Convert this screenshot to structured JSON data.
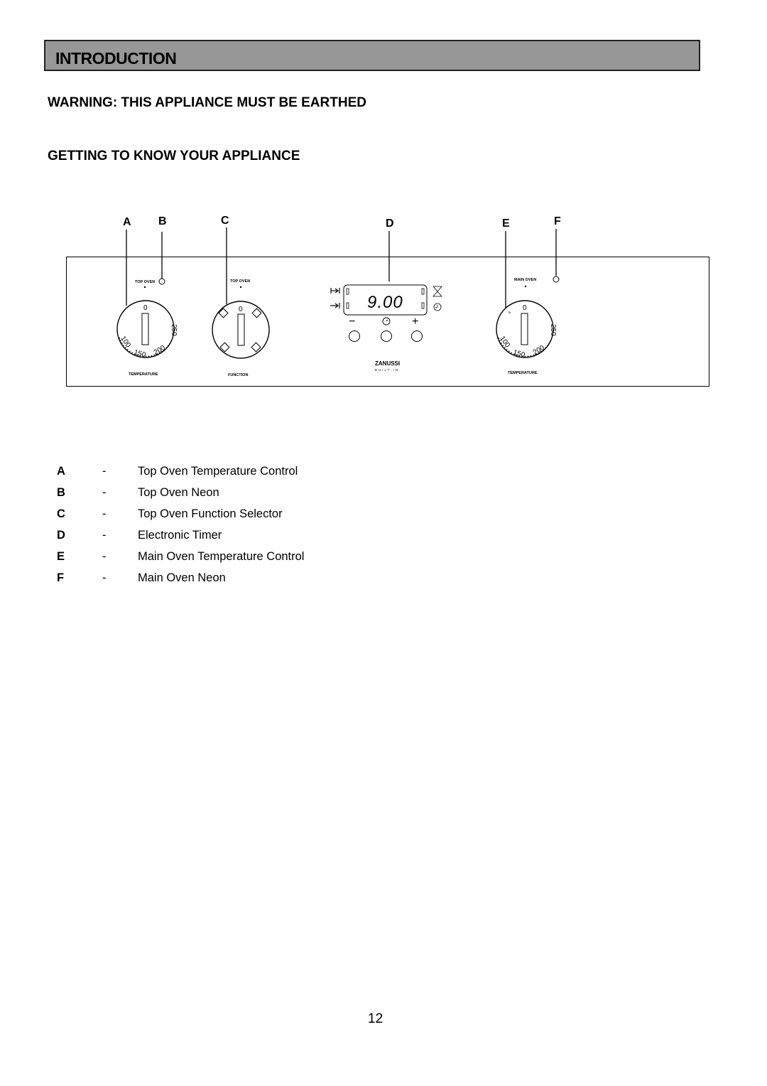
{
  "section_title": "INTRODUCTION",
  "warning_heading": "WARNING: THIS APPLIANCE MUST BE EARTHED",
  "subheading": "GETTING TO KNOW YOUR APPLIANCE",
  "diagram": {
    "callouts": [
      "A",
      "B",
      "C",
      "D",
      "E",
      "F"
    ],
    "top_oven_label_left": "TOP OVEN",
    "top_oven_label_function": "TOP OVEN",
    "main_oven_label": "MAIN OVEN",
    "dial_zero": "0",
    "dial_scale": [
      "100",
      "150",
      "200",
      "250"
    ],
    "temperature_label": "TEMPERATURE",
    "function_label": "FUNCTION",
    "timer_display": "9.00",
    "timer_minus": "−",
    "timer_plus": "+",
    "brand": "ZANUSSI",
    "brand_sub": "BUILT-IN",
    "icons": {
      "cook_time": "cook-time-icon",
      "end_time": "end-time-icon",
      "minute_minder": "hourglass-icon",
      "clock": "clock-icon",
      "manual": "manual-mode-icon"
    }
  },
  "legend": [
    {
      "key": "A",
      "dash": "-",
      "label": "Top Oven Temperature Control"
    },
    {
      "key": "B",
      "dash": "-",
      "label": "Top Oven Neon"
    },
    {
      "key": "C",
      "dash": "-",
      "label": "Top Oven Function Selector"
    },
    {
      "key": "D",
      "dash": "-",
      "label": "Electronic Timer"
    },
    {
      "key": "E",
      "dash": "-",
      "label": "Main Oven Temperature Control"
    },
    {
      "key": "F",
      "dash": "-",
      "label": "Main Oven Neon"
    }
  ],
  "page_number": "12"
}
